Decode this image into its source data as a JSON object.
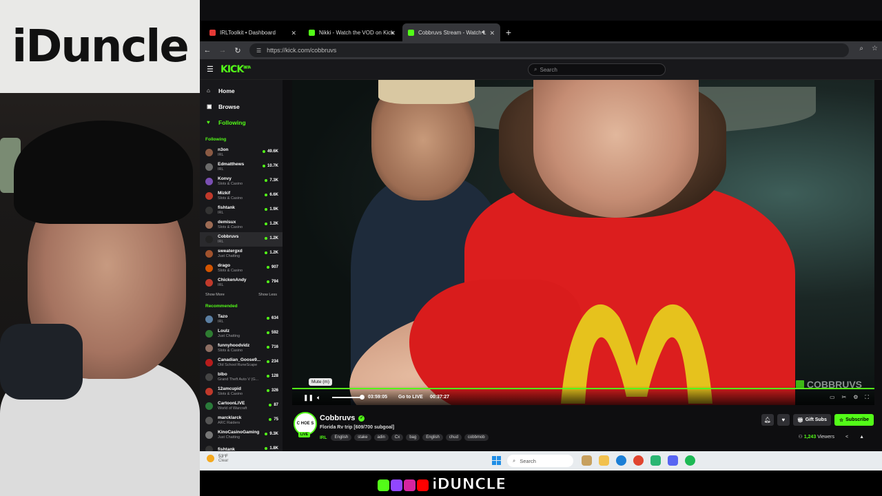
{
  "streamer_overlay": {
    "banner_text": "iDuncle",
    "brand_text": "iDUNCLE"
  },
  "browser": {
    "tabs": [
      {
        "label": "IRLToolkit • Dashboard",
        "color": "#e53935"
      },
      {
        "label": "Nikki - Watch the VOD on Kick",
        "color": "#53fc18"
      },
      {
        "label": "Cobbruvs Stream - Watch L",
        "color": "#53fc18"
      }
    ],
    "new_tab": "+",
    "url": "https://kick.com/cobbruvs"
  },
  "kick": {
    "logo": "KICK",
    "logo_badge": "BETA",
    "search_placeholder": "Search",
    "nav": [
      {
        "label": "Home",
        "icon": "home-icon",
        "glyph": "⌂"
      },
      {
        "label": "Browse",
        "icon": "browse-icon",
        "glyph": "▣"
      },
      {
        "label": "Following",
        "icon": "heart-icon",
        "glyph": "♥"
      }
    ],
    "following_header": "Following",
    "following": [
      {
        "name": "n3on",
        "category": "IRL",
        "viewers": "49.6K",
        "color": "#8a5a44"
      },
      {
        "name": "Edmatthews",
        "category": "IRL",
        "viewers": "10.7K",
        "color": "#6b6b6b"
      },
      {
        "name": "Konvy",
        "category": "Slots & Casino",
        "viewers": "7.3K",
        "color": "#7a4fb3"
      },
      {
        "name": "Mizkif",
        "category": "Slots & Casino",
        "viewers": "6.6K",
        "color": "#c0392b"
      },
      {
        "name": "fishtank",
        "category": "IRL",
        "viewers": "1.9K",
        "color": "#333"
      },
      {
        "name": "demisux",
        "category": "Slots & Casino",
        "viewers": "1.2K",
        "color": "#9c6b54"
      },
      {
        "name": "Cobbruvs",
        "category": "IRL",
        "viewers": "1.2K",
        "color": "#222"
      },
      {
        "name": "sweatergxd",
        "category": "Just Chatting",
        "viewers": "1.2K",
        "color": "#a0522d"
      },
      {
        "name": "drago",
        "category": "Slots & Casino",
        "viewers": "907",
        "color": "#d35400"
      },
      {
        "name": "ChickenAndy",
        "category": "IRL",
        "viewers": "794",
        "color": "#c0392b"
      }
    ],
    "show_more": "Show More",
    "show_less": "Show Less",
    "recommended_header": "Recommended",
    "recommended": [
      {
        "name": "Tazo",
        "category": "IRL",
        "viewers": "634",
        "color": "#5b7fa3"
      },
      {
        "name": "Loulz",
        "category": "Just Chatting",
        "viewers": "592",
        "color": "#2e7d32"
      },
      {
        "name": "funnyhoodvidz",
        "category": "Slots & Casino",
        "viewers": "716",
        "color": "#8d6e63"
      },
      {
        "name": "Canadian_Goose9...",
        "category": "Old School RuneScape",
        "viewers": "234",
        "color": "#b71c1c"
      },
      {
        "name": "blbo",
        "category": "Grand Theft Auto V (G...",
        "viewers": "128",
        "color": "#444"
      },
      {
        "name": "12amcupid",
        "category": "Slots & Casino",
        "viewers": "326",
        "color": "#c0392b"
      },
      {
        "name": "CartoonLIVE",
        "category": "World of Warcraft",
        "viewers": "87",
        "color": "#2a7a3a"
      },
      {
        "name": "marcklarck",
        "category": "ARC Raiders",
        "viewers": "75",
        "color": "#555"
      },
      {
        "name": "KinoCasinoGaming",
        "category": "Just Chatting",
        "viewers": "9.3K",
        "color": "#777"
      },
      {
        "name": "fishtank",
        "category": "",
        "viewers": "1.8K",
        "color": "#333"
      }
    ]
  },
  "player": {
    "tooltip": "Mute (m)",
    "elapsed": "03:59:05",
    "go_live": "Go to LIVE",
    "duration": "00:37:27",
    "watermark": "COBBRUVS",
    "volume_fraction": 0.96
  },
  "stream": {
    "avatar_text": "C HOE S",
    "live_badge": "LIVE",
    "name": "Cobbruvs",
    "title": "Florida Rv trip  [609/700 subgoal]",
    "category": "IRL",
    "tags": [
      "English",
      "stake",
      "adin",
      "Cx",
      "bag",
      "English",
      "chud",
      "cobbmob"
    ],
    "gift_label": "Gift Subs",
    "subscribe_label": "Subscribe",
    "viewers_count": "1,243",
    "viewers_label": "Viewers"
  },
  "taskbar": {
    "temp": "53°F",
    "condition": "Clear",
    "search_placeholder": "Search"
  }
}
